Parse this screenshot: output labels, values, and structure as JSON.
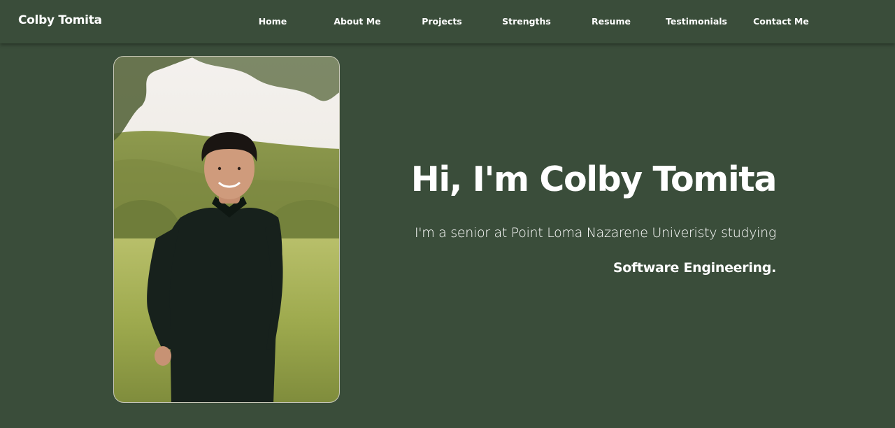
{
  "nav": {
    "brand": "Colby Tomita",
    "items": [
      {
        "label": "Home",
        "id": "home"
      },
      {
        "label": "About Me",
        "id": "about-me"
      },
      {
        "label": "Projects",
        "id": "projects"
      },
      {
        "label": "Strengths",
        "id": "strengths"
      },
      {
        "label": "Resume",
        "id": "resume"
      },
      {
        "label": "Testimonials",
        "id": "testimonials"
      },
      {
        "label": "Contact Me",
        "id": "contact-me"
      }
    ]
  },
  "hero": {
    "title": "Hi, I'm Colby Tomita",
    "subtitle_part1": "I'm a senior at Point Loma Nazarene Univeristy studying ",
    "subtitle_bold": "Software Engineering."
  },
  "colors": {
    "background": "#3a4d3a",
    "text": "#ffffff"
  }
}
